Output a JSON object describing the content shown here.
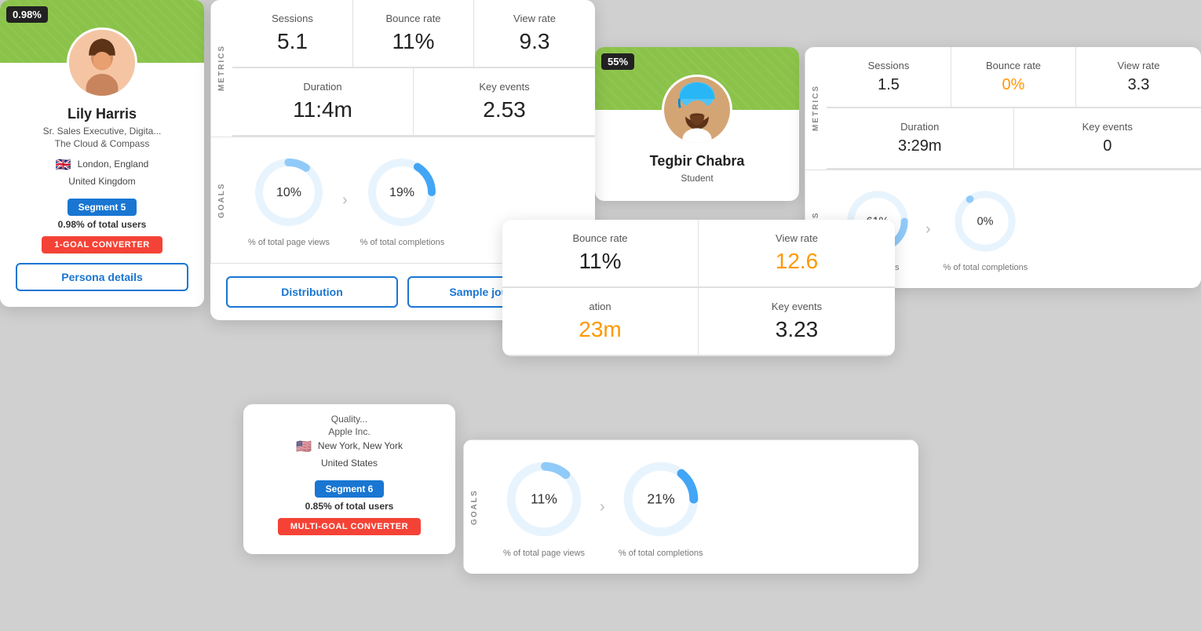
{
  "card1": {
    "percentage": "0.98%",
    "name": "Lily Harris",
    "title": "Sr. Sales Executive, Digita...",
    "company": "The Cloud & Compass",
    "location_city": "London, England",
    "location_country": "United Kingdom",
    "location_flag": "🇬🇧",
    "segment": "Segment 5",
    "total_users": "0.98% of total users",
    "converter_label": "1-GOAL CONVERTER",
    "details_btn": "Persona details",
    "metrics": {
      "sessions_label": "Sessions",
      "sessions_value": "5.1",
      "bounce_rate_label": "Bounce rate",
      "bounce_rate_value": "11%",
      "view_rate_label": "View rate",
      "view_rate_value": "9.3",
      "duration_label": "Duration",
      "duration_value": "11:4m",
      "key_events_label": "Key events",
      "key_events_value": "2.53"
    },
    "goals": {
      "label": "GOALS",
      "page_views_pct": "10%",
      "page_views_label": "% of total page views",
      "completions_pct": "19%",
      "completions_label": "% of total completions"
    },
    "buttons": {
      "distribution": "Distribution",
      "sample_journeys": "Sample journeys"
    }
  },
  "card2": {
    "percentage": "55%",
    "name": "Tegbir Chabra",
    "title": "Student",
    "metrics": {
      "sessions_label": "Sessions",
      "sessions_value": "1.5",
      "bounce_rate_label": "Bounce rate",
      "bounce_rate_value": "0%",
      "view_rate_label": "View rate",
      "view_rate_value": "3.3",
      "duration_label": "Duration",
      "duration_value": "3:29m",
      "key_events_label": "Key events",
      "key_events_value": "0"
    },
    "partial": {
      "bounce_rate_label": "Bounce rate",
      "bounce_rate_value": "11%",
      "view_rate_label": "View rate",
      "view_rate_value": "12.6",
      "duration_label": "ation",
      "duration_value": "23m",
      "key_events_label": "Key events",
      "key_events_value": "3.23"
    },
    "goals": {
      "page_views_pct": "61%",
      "page_views_label": "page views",
      "completions_pct": "0%",
      "completions_label": "% of total completions"
    }
  },
  "card3": {
    "title_line1": "Quality...",
    "title_line2": "Apple Inc.",
    "location_city": "New York, New York",
    "location_country": "United States",
    "location_flag": "🇺🇸",
    "segment": "Segment 6",
    "total_users": "0.85% of total users",
    "converter_label": "MULTI-GOAL CONVERTER",
    "goals": {
      "label": "GOALS",
      "page_views_pct": "11%",
      "page_views_label": "% of total page views",
      "completions_pct": "21%",
      "completions_label": "% of total completions"
    }
  },
  "icons": {
    "metrics_label": "METRICS",
    "goals_label": "GOALS"
  }
}
